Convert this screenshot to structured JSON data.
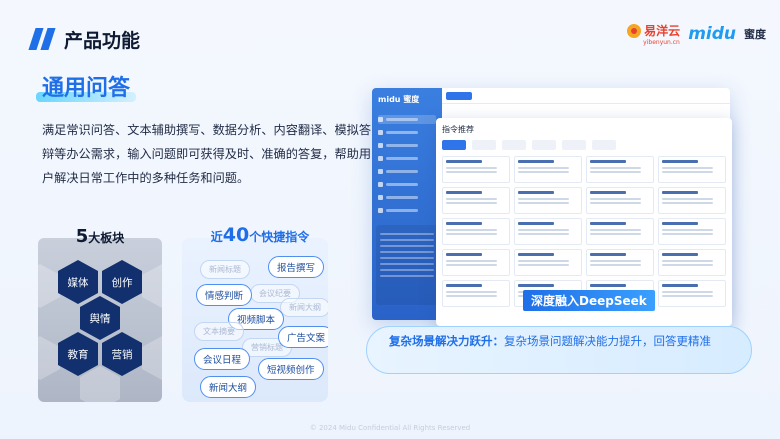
{
  "header": {
    "title": "产品功能"
  },
  "brand": {
    "yb_name": "易洋云",
    "yb_url": "yibenyun.cn",
    "midu_name": "midu",
    "midu_cn": "蜜度"
  },
  "section": {
    "title": "通用问答"
  },
  "description": "满足常识问答、文本辅助撰写、数据分析、内容翻译、模拟答辩等办公需求，输入问题即可获得及时、准确的答复，帮助用户解决日常工作中的多种任务和问题。",
  "modules": {
    "count": "5",
    "suffix": "大板块",
    "items": [
      "媒体",
      "创作",
      "舆情",
      "教育",
      "营销"
    ]
  },
  "quick": {
    "prefix": "近",
    "count": "40",
    "suffix": "个快捷指令",
    "strong": [
      "报告撰写",
      "情感判断",
      "视频脚本",
      "广告文案",
      "会议日程",
      "短视频创作",
      "新闻大纲"
    ],
    "faint": [
      "新闻标题",
      "会议纪要",
      "新闻大纲",
      "文本摘要",
      "营销标题"
    ]
  },
  "screenshot": {
    "logo": "midu 蜜度",
    "panel_title": "指令推荐"
  },
  "deepseek": "深度融入DeepSeek",
  "banner": {
    "highlight": "复杂场景解决力跃升：",
    "rest": "复杂场景问题解决能力提升，回答更精准"
  },
  "footer": "© 2024 Midu Confidential All Rights Reserved",
  "colors": {
    "accent": "#1f6fe8",
    "hex": "#12306e"
  }
}
